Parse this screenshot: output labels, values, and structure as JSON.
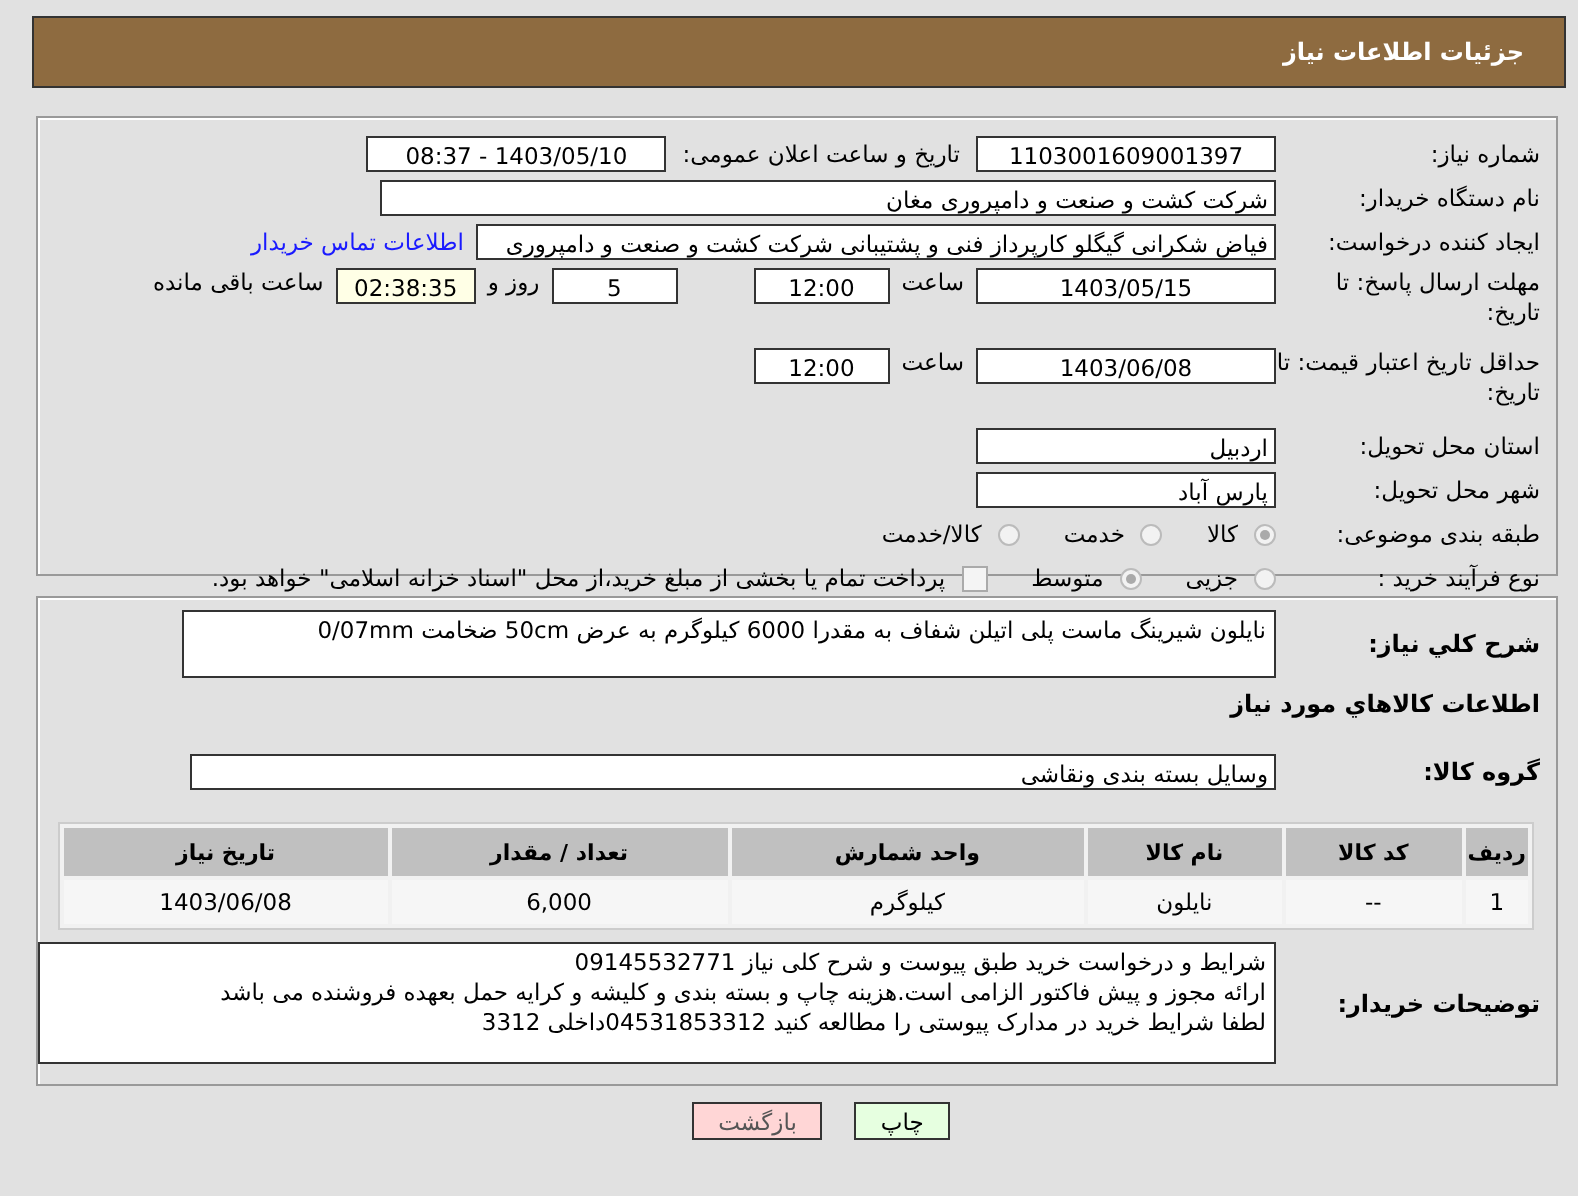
{
  "header": {
    "title": "جزئیات اطلاعات نیاز"
  },
  "need_number": {
    "label": "شماره نیاز:",
    "value": "1103001609001397"
  },
  "announce": {
    "label": "تاریخ و ساعت اعلان عمومی:",
    "value": "1403/05/10 - 08:37"
  },
  "buyer_org": {
    "label": "نام دستگاه خریدار:",
    "value": "شرکت کشت و صنعت و دامپروری مغان"
  },
  "requester": {
    "label": "ایجاد کننده درخواست:",
    "value": "فیاض شکرانی گیگلو کارپرداز فنی و پشتیبانی شرکت کشت و صنعت و دامپروری",
    "link": "اطلاعات تماس خریدار"
  },
  "deadline": {
    "label": "مهلت ارسال پاسخ: تا تاریخ:",
    "date": "1403/05/15",
    "time_label": "ساعت",
    "time": "12:00",
    "days": "5",
    "days_label": "روز و",
    "remaining": "02:38:35",
    "remaining_label": "ساعت باقی مانده"
  },
  "validity": {
    "label": "حداقل تاریخ اعتبار قیمت: تا تاریخ:",
    "date": "1403/06/08",
    "time_label": "ساعت",
    "time": "12:00"
  },
  "province": {
    "label": "استان محل تحویل:",
    "value": "اردبیل"
  },
  "city": {
    "label": "شهر محل تحویل:",
    "value": "پارس آباد"
  },
  "category": {
    "label": "طبقه بندی موضوعی:",
    "options": [
      {
        "label": "کالا",
        "selected": true,
        "disabled": true
      },
      {
        "label": "خدمت",
        "selected": false,
        "disabled": true
      },
      {
        "label": "کالا/خدمت",
        "selected": false,
        "disabled": true
      }
    ]
  },
  "process": {
    "label": "نوع فرآیند خرید :",
    "options": [
      {
        "label": "جزیی",
        "selected": false,
        "disabled": true
      },
      {
        "label": "متوسط",
        "selected": true,
        "disabled": true
      }
    ],
    "checkbox": {
      "label": "پرداخت تمام یا بخشی از مبلغ خرید،از محل \"اسناد خزانه اسلامی\" خواهد بود.",
      "checked": false
    }
  },
  "description": {
    "label": "شرح کلي نياز:",
    "value": "نایلون شیرینگ ماست پلی اتیلن شفاف به مقدرا 6000 کیلوگرم  به عرض 50cm ضخامت  0/07mm"
  },
  "goods_title": "اطلاعات کالاهاي مورد نياز",
  "group": {
    "label": "گروه کالا:",
    "value": "وسایل بسته بندی  ونقاشی"
  },
  "table": {
    "columns": [
      "ردیف",
      "کد کالا",
      "نام کالا",
      "واحد شمارش",
      "تعداد / مقدار",
      "تاریخ نیاز"
    ],
    "rows": [
      [
        "1",
        "--",
        "نایلون",
        "کیلوگرم",
        "6,000",
        "1403/06/08"
      ]
    ]
  },
  "notes": {
    "label": "توضیحات خریدار:",
    "lines": [
      "شرایط و درخواست خرید طبق پیوست و شرح کلی نیاز 09145532771",
      "ارائه مجوز و پیش فاکتور الزامی است.هزینه چاپ و بسته بندی و کلیشه و کرایه حمل بعهده فروشنده می باشد",
      "لطفا شرایط خرید در مدارک پیوستی را مطالعه کنید 04531853312داخلی 3312"
    ]
  },
  "buttons": [
    {
      "label": "چاپ",
      "kind": "print"
    },
    {
      "label": "بازگشت",
      "kind": "back"
    }
  ]
}
